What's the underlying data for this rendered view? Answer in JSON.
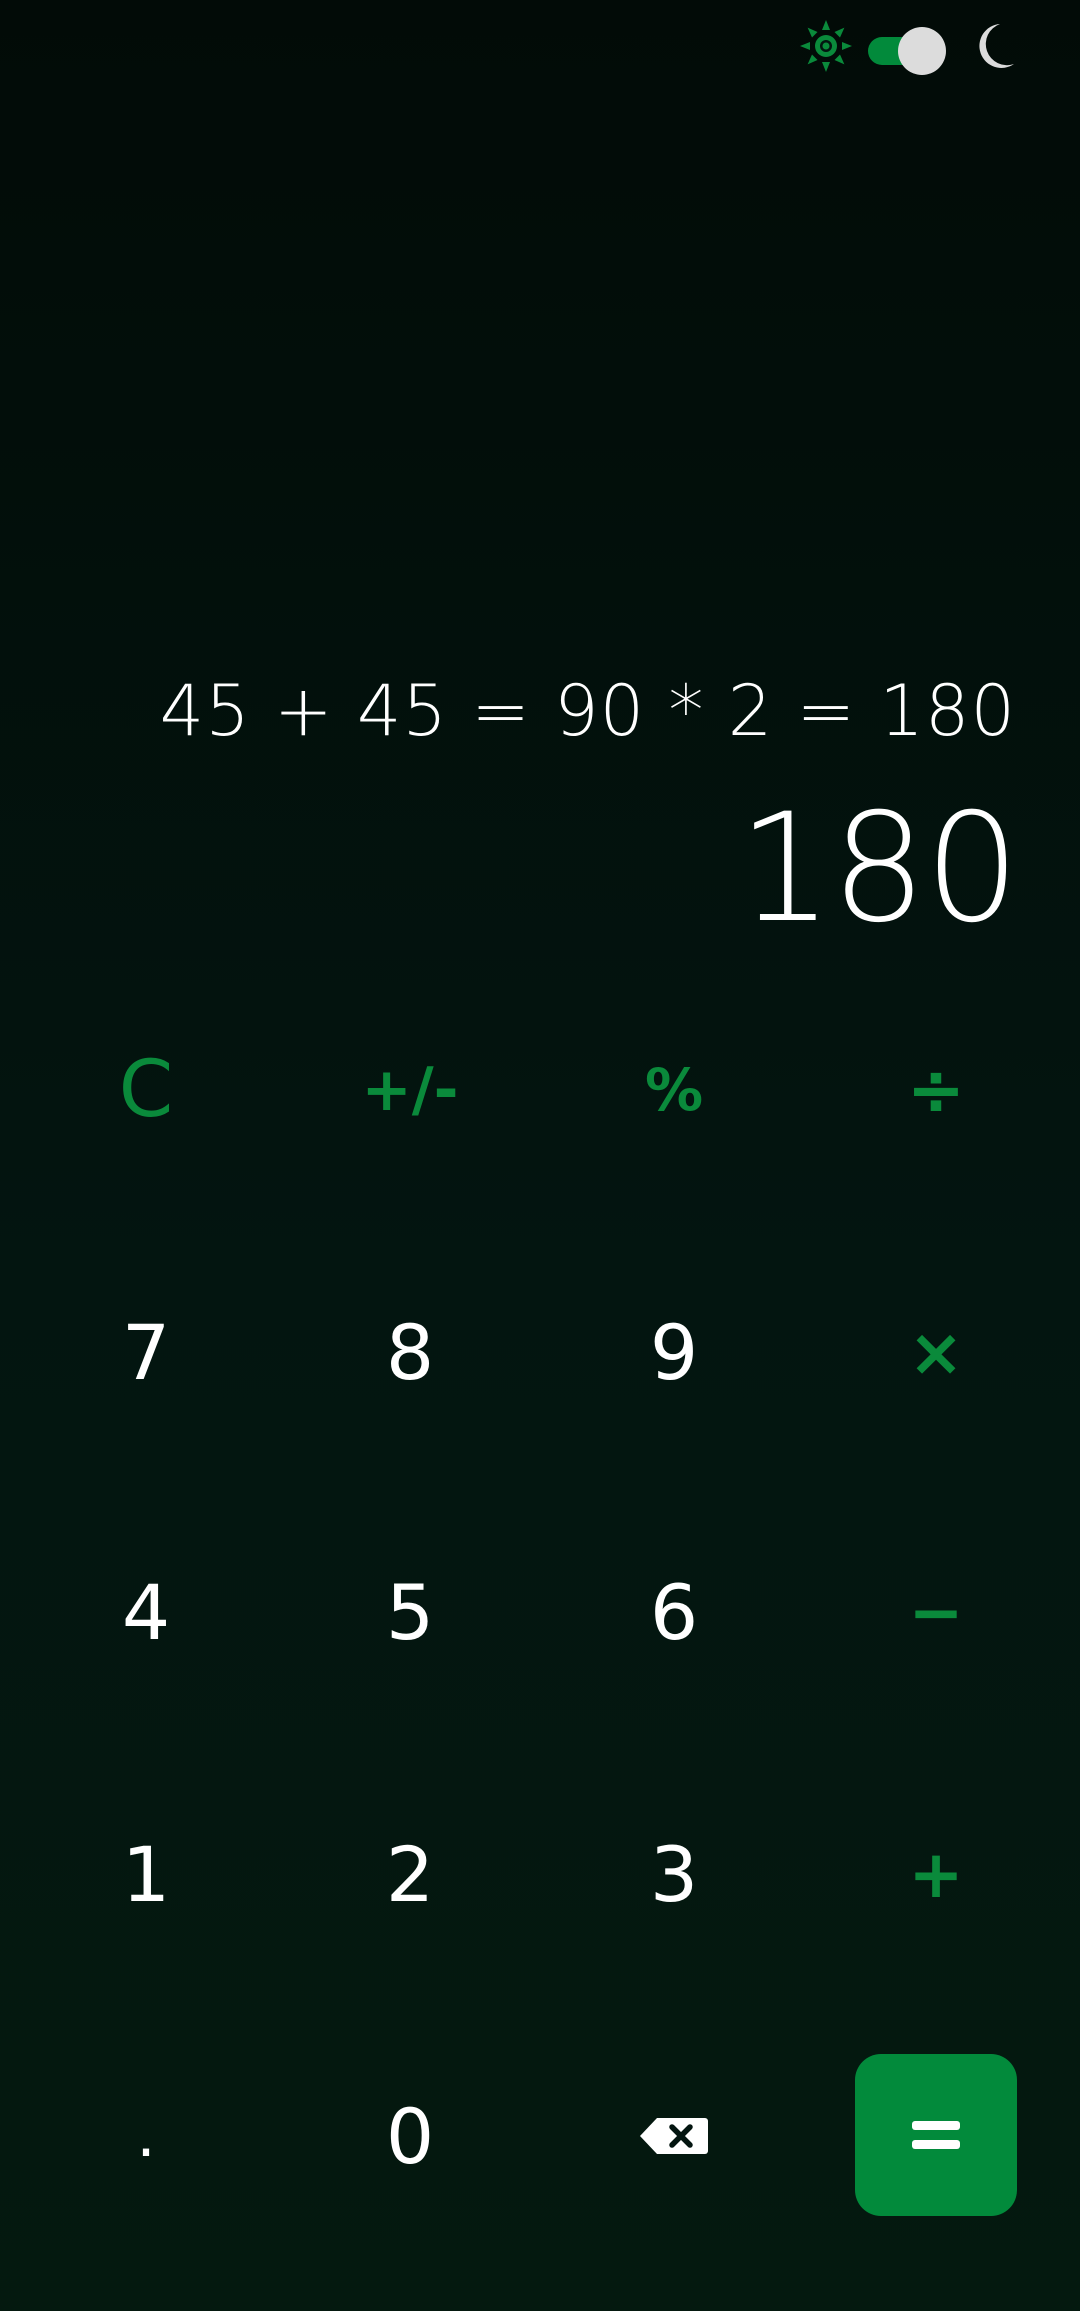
{
  "theme": {
    "accent": "#028a3b",
    "background": "#031510",
    "text": "#ffffff",
    "icons": [
      "sun-icon",
      "toggle-switch",
      "moon-icon"
    ],
    "dark_mode": true
  },
  "display": {
    "expression": "45 + 45 = 90 * 2 = 180",
    "result": "180"
  },
  "keypad": {
    "clear": "C",
    "sign": "+/-",
    "percent": "%",
    "divide": "÷",
    "seven": "7",
    "eight": "8",
    "nine": "9",
    "multiply": "×",
    "four": "4",
    "five": "5",
    "six": "6",
    "minus": "−",
    "one": "1",
    "two": "2",
    "three": "3",
    "plus": "+",
    "decimal": ".",
    "zero": "0",
    "backspace": "backspace-icon",
    "equals": "="
  }
}
